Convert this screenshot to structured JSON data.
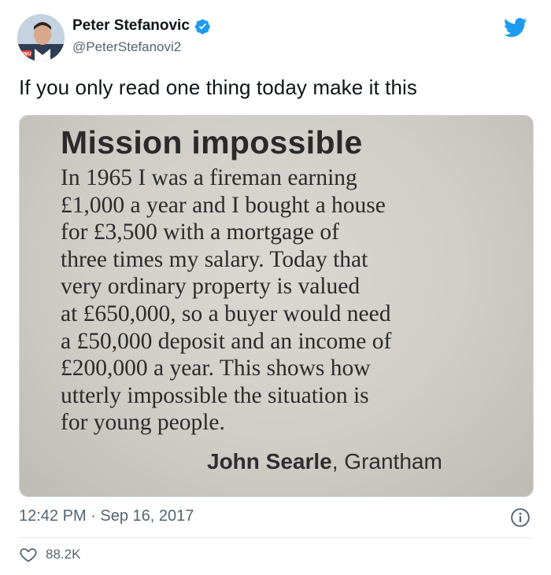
{
  "author": {
    "display_name": "Peter Stefanovic",
    "handle": "@PeterStefanovi2",
    "verified": true,
    "avatar_badge": "CWU"
  },
  "tweet": {
    "text": "If you only read one thing today make it this",
    "timestamp": "12:42 PM · Sep 16, 2017",
    "likes": "88.2K"
  },
  "clipping": {
    "headline": "Mission impossible",
    "lines": [
      "In 1965 I was a fireman earning",
      "£1,000 a year and I bought a house",
      "for £3,500 with a mortgage of",
      "three times my salary. Today that",
      "very ordinary property is valued",
      "at £650,000, so a buyer would need",
      "a £50,000 deposit and an income of",
      "£200,000 a year. This shows how",
      "utterly impossible the situation is",
      "for young people."
    ],
    "signature_name": "John Searle",
    "signature_sep": ",",
    "signature_place": " Grantham"
  },
  "icons": {
    "verified": "verified-badge-icon",
    "logo": "twitter-bird-icon",
    "info": "info-icon",
    "like": "heart-icon"
  },
  "colors": {
    "twitter_blue": "#1d9bf0",
    "secondary_text": "#536471",
    "primary_text": "#0f1419"
  }
}
